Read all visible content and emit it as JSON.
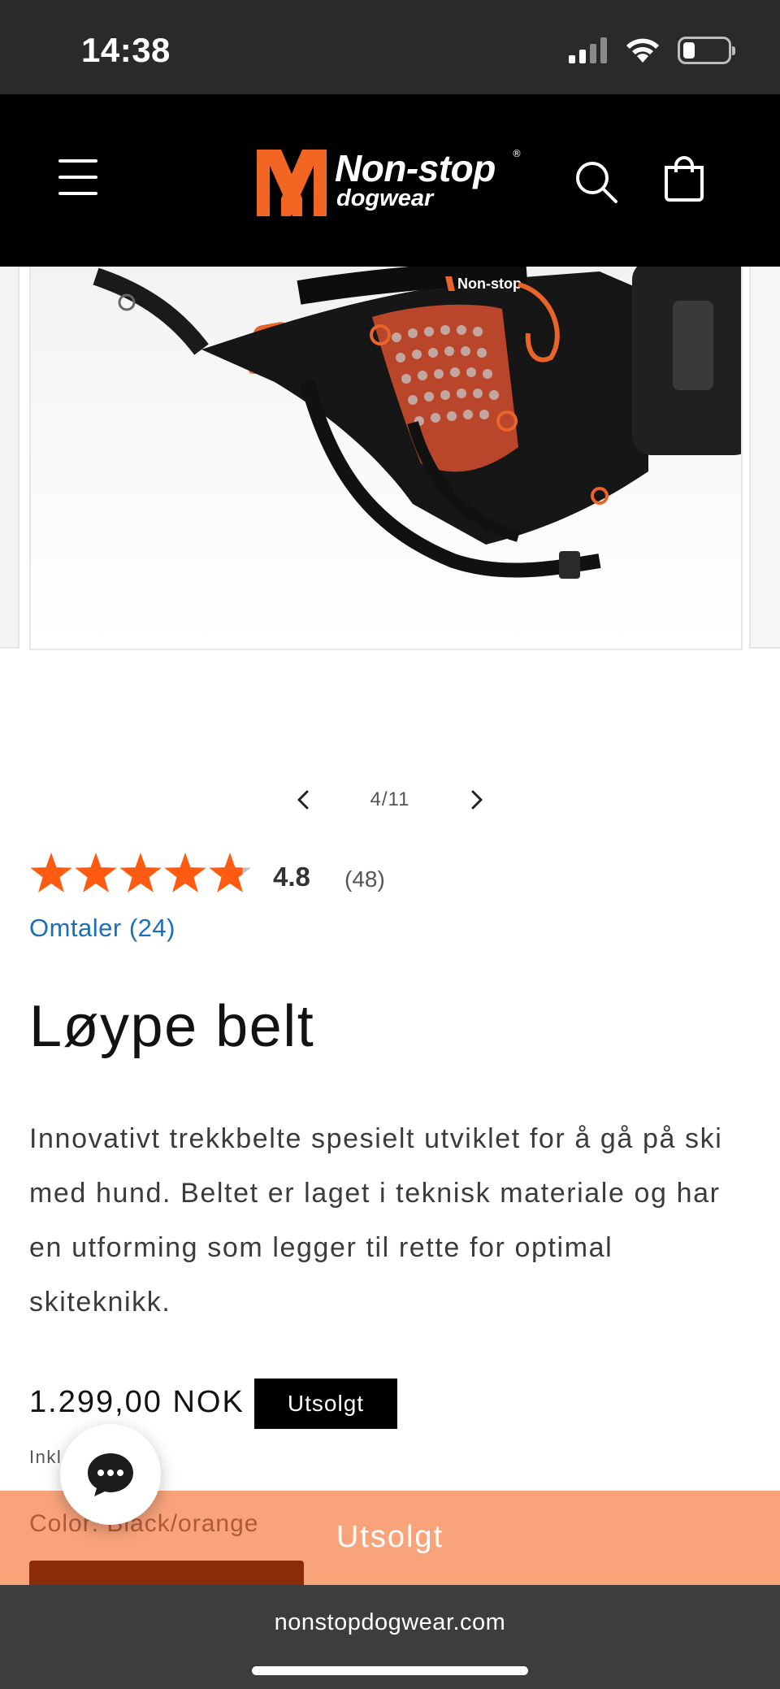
{
  "status_bar": {
    "time": "14:38",
    "icons": [
      "cellular-signal-icon",
      "wifi-icon",
      "battery-icon"
    ]
  },
  "header": {
    "logo_main": "Non-stop",
    "logo_sub": "dogwear",
    "logo_registered": "®",
    "icons": [
      "menu-icon",
      "search-icon",
      "cart-icon"
    ],
    "brand_color": "#f26522"
  },
  "gallery": {
    "counter": "4/11",
    "current_slide": 4,
    "total_slides": 11,
    "image_subject": "ski-belt-product-photo",
    "badge_text": "Non-stop dogwear",
    "size_marker": "M"
  },
  "rating": {
    "value": "4.8",
    "count": "(48)",
    "stars_filled": 4.8,
    "stars_max": 5,
    "star_color": "#ff5a12",
    "star_empty_color": "#bdbdbd",
    "reviews_link": "Omtaler (24)"
  },
  "product": {
    "title": "Løype belt",
    "description": "Innovativt trekkbelte spesielt utviklet for å gå på ski med hund. Beltet er laget i teknisk materiale og har en utforming som legger til rette for optimal skiteknikk.",
    "price": "1.299,00 NOK",
    "sold_out_badge": "Utsolgt",
    "tax_note": "Inkl. avgifter."
  },
  "sticky_bar": {
    "color_label": "Color: Black/orange",
    "sold_out_button": "Utsolgt",
    "background": "#f9a37b"
  },
  "chat": {
    "icon": "chat-bubble-icon"
  },
  "browser": {
    "url": "nonstopdogwear.com"
  }
}
